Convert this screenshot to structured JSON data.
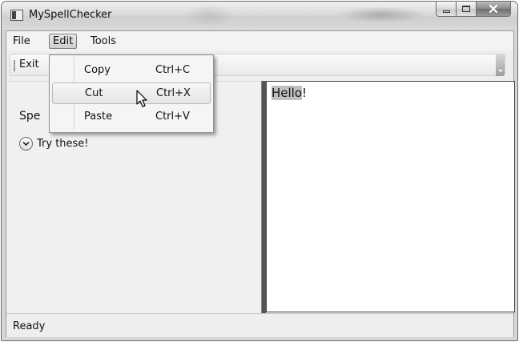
{
  "window": {
    "title": "MySpellChecker"
  },
  "menu": {
    "file": "File",
    "edit": "Edit",
    "tools": "Tools"
  },
  "toolbar": {
    "exit": "Exit"
  },
  "edit_menu": {
    "items": [
      {
        "label": "Copy",
        "shortcut": "Ctrl+C"
      },
      {
        "label": "Cut",
        "shortcut": "Ctrl+X"
      },
      {
        "label": "Paste",
        "shortcut": "Ctrl+V"
      }
    ]
  },
  "left_panel": {
    "spell_label": "Spe",
    "expander_label": "Try these!"
  },
  "editor": {
    "selected_text": "Hello",
    "remaining_text": "!"
  },
  "status": {
    "text": "Ready"
  },
  "icons": {
    "app": "window-icon",
    "minimize": "minimize-icon",
    "maximize": "maximize-icon",
    "close": "close-icon",
    "expander": "chevron-down-icon",
    "cursor": "mouse-pointer-icon"
  }
}
